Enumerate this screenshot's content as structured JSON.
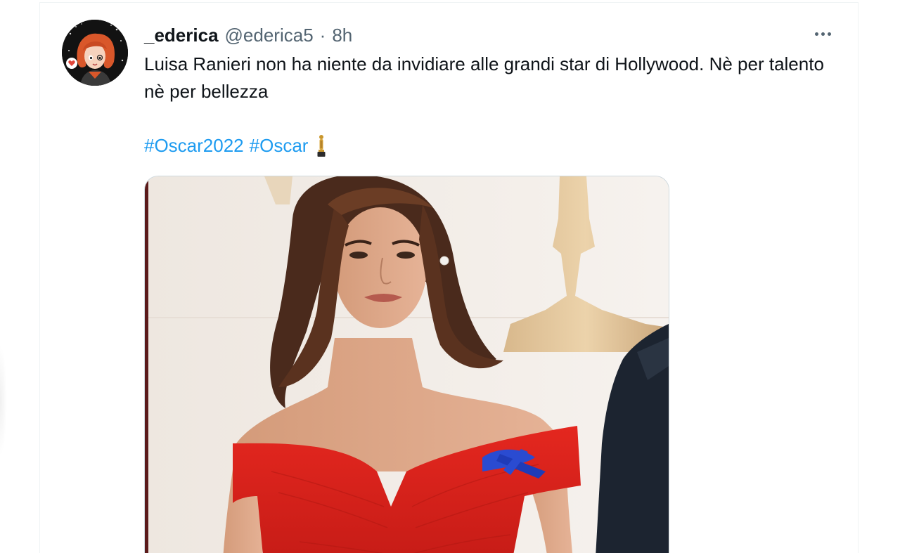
{
  "tweet": {
    "display_name": "_ederica",
    "handle": "@ederica5",
    "separator": "·",
    "time": "8h",
    "text": "Luisa Ranieri non ha niente da invidiare alle grandi star di Hollywood. Nè per talento nè per bellezza",
    "hashtags": [
      "#Oscar2022",
      "#Oscar"
    ],
    "emoji": "trophy-statue-icon"
  },
  "colors": {
    "link": "#1d9bf0",
    "text": "#0f1419",
    "secondary": "#536471",
    "border": "#eff3f4",
    "dress": "#e0231d"
  },
  "icons": {
    "more": "more-horizontal-icon",
    "avatar": "illustrated-avatar",
    "media": "photo-woman-red-dress"
  }
}
